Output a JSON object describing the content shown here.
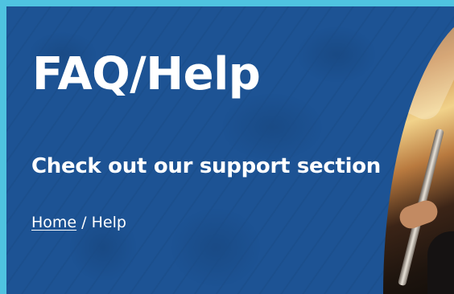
{
  "hero": {
    "title": "FAQ/Help",
    "subtitle": "Check out our support section",
    "breadcrumb": {
      "home_label": "Home",
      "separator": "/",
      "current_label": "Help"
    }
  },
  "colors": {
    "outer_border": "#4fc3e0",
    "hero_background": "#1d5394",
    "text": "#ffffff"
  }
}
